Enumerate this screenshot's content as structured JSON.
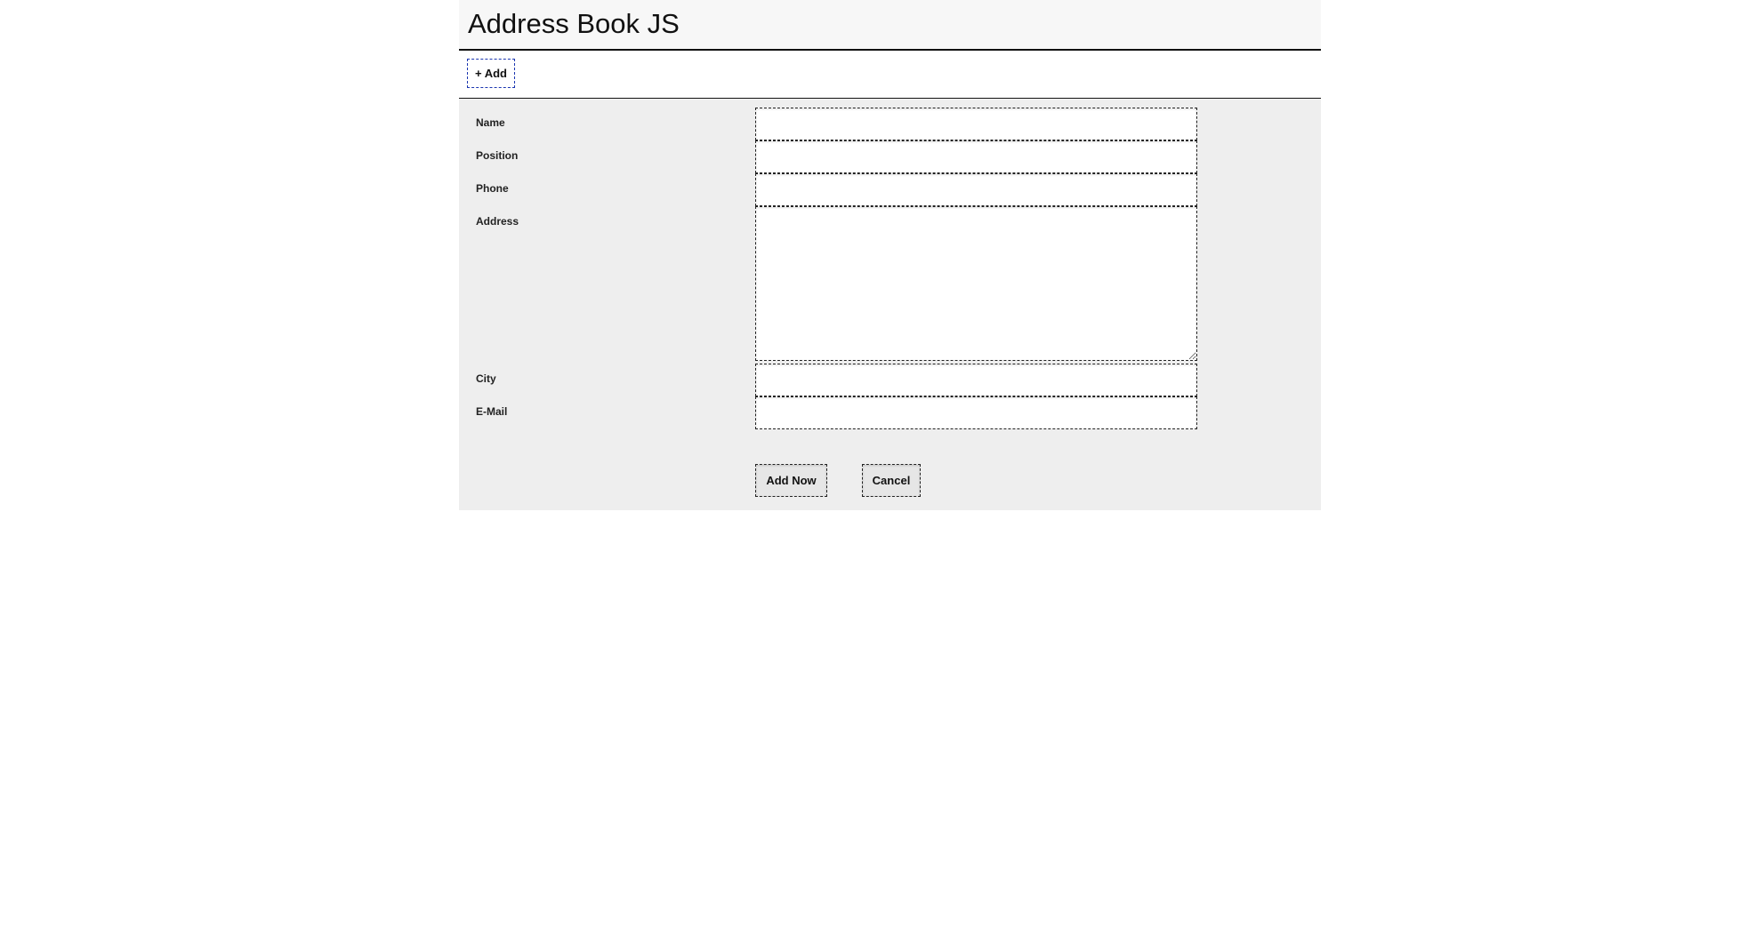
{
  "app": {
    "title": "Address Book JS"
  },
  "toolbar": {
    "add_label": "+ Add"
  },
  "form": {
    "fields": [
      {
        "key": "name",
        "label": "Name",
        "value": "",
        "placeholder": ""
      },
      {
        "key": "position",
        "label": "Position",
        "value": "",
        "placeholder": ""
      },
      {
        "key": "phone",
        "label": "Phone",
        "value": "",
        "placeholder": ""
      },
      {
        "key": "address",
        "label": "Address",
        "value": "",
        "placeholder": ""
      },
      {
        "key": "city",
        "label": "City",
        "value": "",
        "placeholder": ""
      },
      {
        "key": "email",
        "label": "E-Mail",
        "value": "",
        "placeholder": ""
      }
    ],
    "submit_label": "Add Now",
    "cancel_label": "Cancel"
  },
  "colors": {
    "header_bg": "#f7f7f7",
    "panel_bg": "#eeeeee",
    "focus_border": "#1a35b0",
    "text": "#111111"
  }
}
